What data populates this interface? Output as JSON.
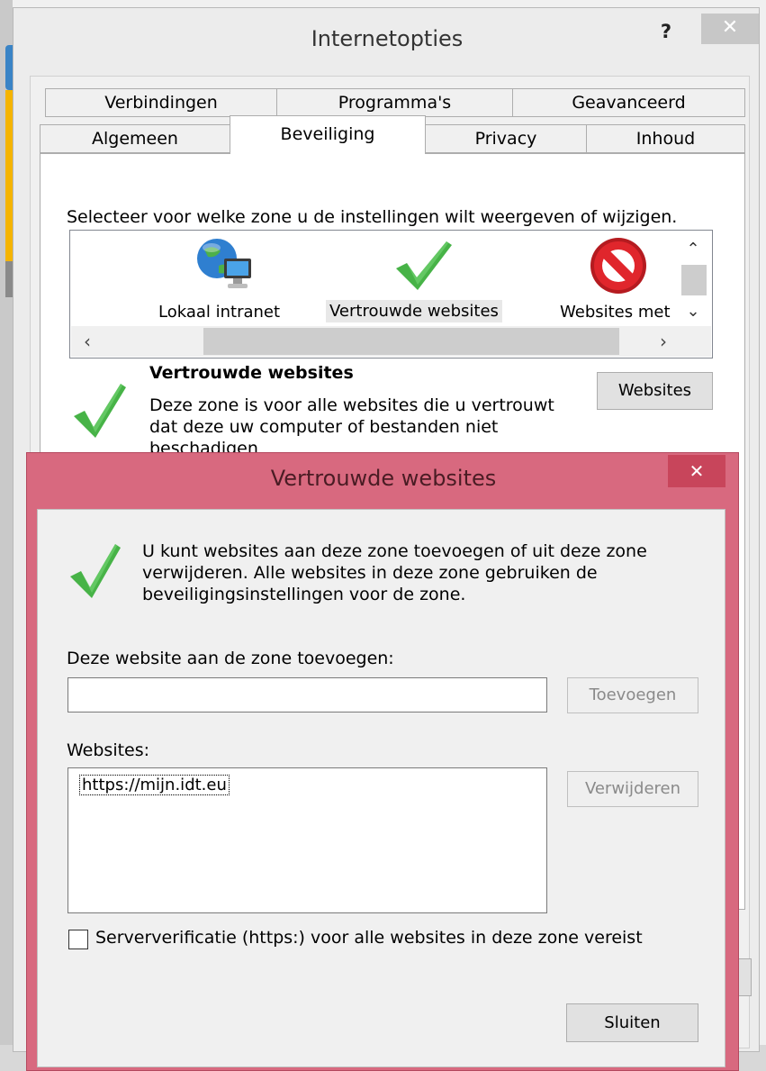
{
  "main_window": {
    "title": "Internetopties",
    "help_label": "?",
    "close_label": "✕"
  },
  "tabs": {
    "row1": [
      "Verbindingen",
      "Programma's",
      "Geavanceerd"
    ],
    "row2": [
      "Algemeen",
      "Beveiliging",
      "Privacy",
      "Inhoud"
    ],
    "selected": "Beveiliging"
  },
  "security": {
    "instruction": "Selecteer voor welke zone u de instellingen wilt weergeven of wijzigen.",
    "zones": [
      {
        "label": "Lokaal intranet",
        "icon": "globe-computer-icon"
      },
      {
        "label": "Vertrouwde websites",
        "icon": "checkmark-icon",
        "selected": true
      },
      {
        "label": "Websites met",
        "icon": "no-entry-icon"
      }
    ],
    "selected_zone_title": "Vertrouwde websites",
    "selected_zone_desc": "Deze zone is voor alle websites die u vertrouwt dat deze uw computer of bestanden niet beschadigen",
    "websites_button": "Websites"
  },
  "dialog": {
    "title": "Vertrouwde websites",
    "close_label": "✕",
    "info": "U kunt websites aan deze zone toevoegen of uit deze zone verwijderen. Alle websites in deze zone gebruiken de beveiligingsinstellingen voor de zone.",
    "add_label": "Deze website aan de zone toevoegen:",
    "add_input_value": "",
    "add_button": "Toevoegen",
    "websites_label": "Websites:",
    "websites": [
      "https://mijn.idt.eu"
    ],
    "remove_button": "Verwijderen",
    "https_checkbox_label": "Serververificatie (https:) voor alle websites in deze zone vereist",
    "https_checked": false,
    "close_button": "Sluiten"
  },
  "colors": {
    "dialog_frame": "#d8697f",
    "check_green": "#3fae3f",
    "no_entry_red": "#d9262b"
  }
}
